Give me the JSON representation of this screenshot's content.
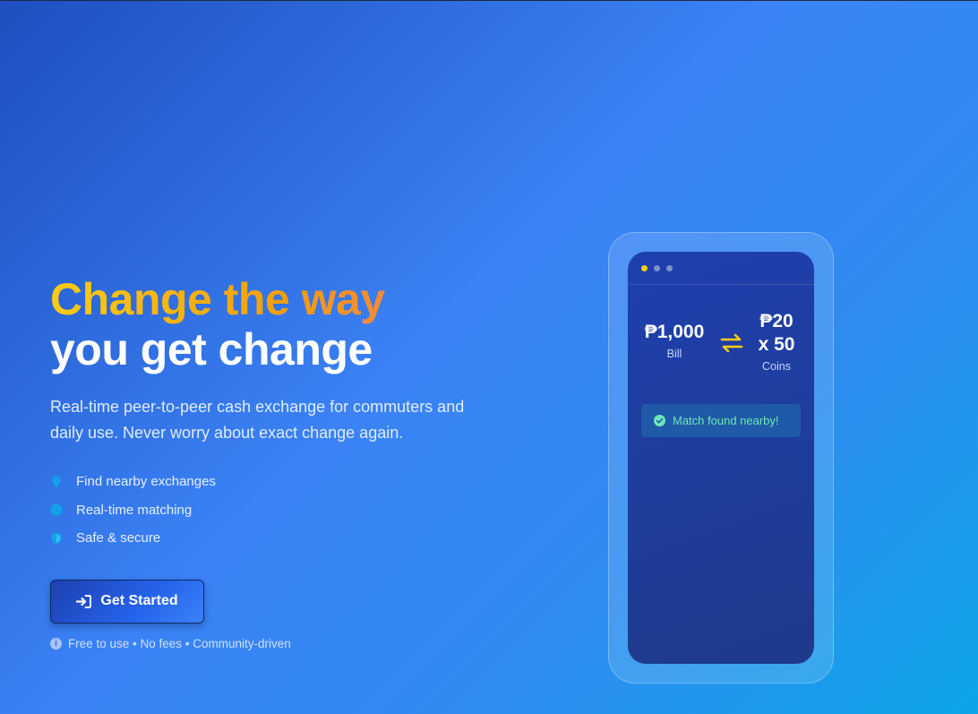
{
  "hero": {
    "headline_line1": "Change the way",
    "headline_line2": "you get change",
    "subtitle": "Real-time peer-to-peer cash exchange for commuters and daily use. Never worry about exact change again.",
    "features": [
      {
        "icon": "map-pin-icon",
        "label": "Find nearby exchanges"
      },
      {
        "icon": "clock-icon",
        "label": "Real-time matching"
      },
      {
        "icon": "shield-icon",
        "label": "Safe & secure"
      }
    ],
    "cta_label": "Get Started",
    "note": "Free to use • No fees • Community-driven"
  },
  "phone": {
    "bill_amount": "₱1,000",
    "bill_label": "Bill",
    "coins_amount_line1": "₱20",
    "coins_amount_line2": "x 50",
    "coins_label": "Coins",
    "match_text": "Match found nearby!"
  },
  "colors": {
    "accent_yellow": "#facc15",
    "match_green": "#6ee7b7",
    "feature_icon": "#0ea5e9"
  }
}
